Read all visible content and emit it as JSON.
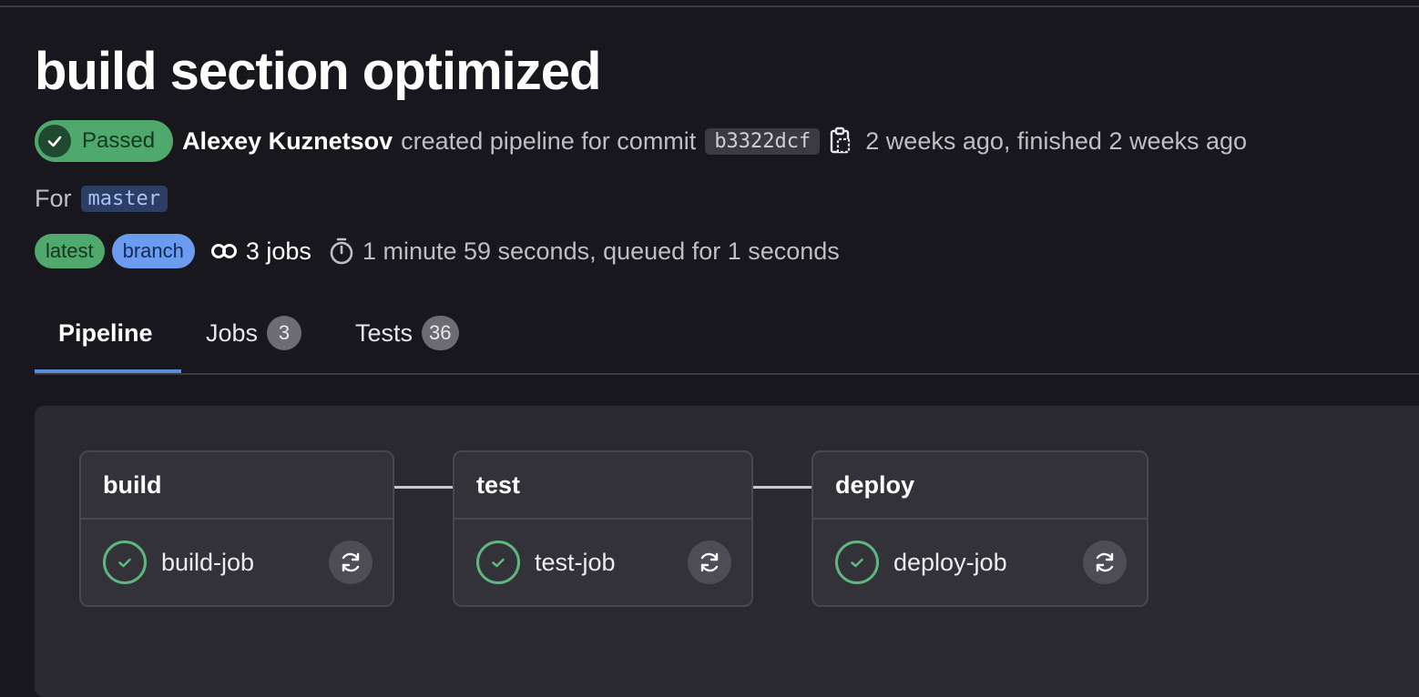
{
  "pipeline": {
    "title": "build section optimized",
    "status": "Passed",
    "author": "Alexey Kuznetsov",
    "action_text": "created pipeline for commit",
    "commit_sha": "b3322dcf",
    "timing": "2 weeks ago, finished 2 weeks ago",
    "for_label": "For",
    "ref": "master",
    "labels": [
      "latest",
      "branch"
    ],
    "jobs_count": "3 jobs",
    "duration": "1 minute 59 seconds, queued for 1 seconds"
  },
  "tabs": [
    {
      "label": "Pipeline",
      "active": true
    },
    {
      "label": "Jobs",
      "count": "3"
    },
    {
      "label": "Tests",
      "count": "36"
    }
  ],
  "stages": [
    {
      "name": "build",
      "job": "build-job",
      "status": "success"
    },
    {
      "name": "test",
      "job": "test-job",
      "status": "success"
    },
    {
      "name": "deploy",
      "job": "deploy-job",
      "status": "success"
    }
  ],
  "colors": {
    "success": "#4fa86c",
    "branch": "#6b9cf0",
    "active_tab": "#5a8fd8"
  },
  "icons": {
    "status": "check-circle-icon",
    "copy": "clipboard-icon",
    "jobs": "link-icon",
    "duration": "stopwatch-icon",
    "retry": "retry-icon"
  }
}
